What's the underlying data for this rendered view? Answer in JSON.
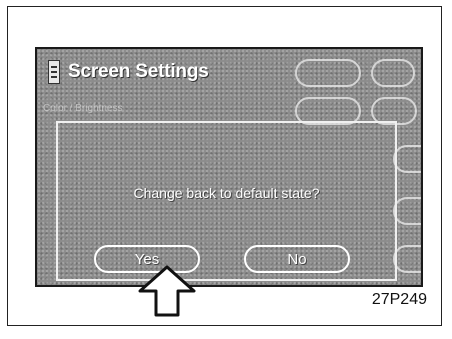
{
  "screen": {
    "title": "Screen Settings",
    "background_label": "Color / Brightness"
  },
  "dialog": {
    "message": "Change back to default state?",
    "yes_label": "Yes",
    "no_label": "No"
  },
  "figure_code": "27P249",
  "colors": {
    "screen_bg": "#8c8c8c",
    "text": "#ffffff",
    "border": "#1a1a1a"
  }
}
